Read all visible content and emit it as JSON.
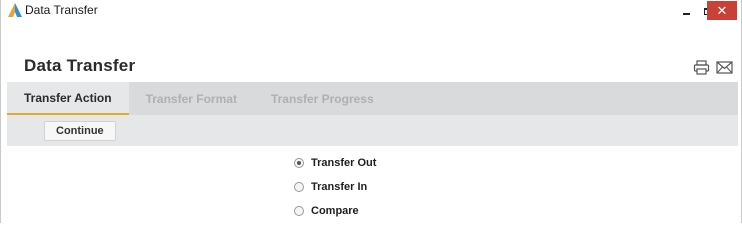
{
  "window": {
    "title": "Data Transfer",
    "icon": "app-logo-icon",
    "controls": {
      "minimize": "minimize-icon",
      "maximize": "maximize-icon",
      "close_label": "✕"
    }
  },
  "page": {
    "title": "Data Transfer",
    "icons": [
      "print-icon",
      "email-icon"
    ]
  },
  "tabs": [
    {
      "label": "Transfer Action",
      "active": true
    },
    {
      "label": "Transfer Format",
      "active": false
    },
    {
      "label": "Transfer Progress",
      "active": false
    }
  ],
  "actions": {
    "continue_label": "Continue"
  },
  "options": [
    {
      "label": "Transfer Out",
      "checked": true
    },
    {
      "label": "Transfer In",
      "checked": false
    },
    {
      "label": "Compare",
      "checked": false
    }
  ],
  "colors": {
    "tab_active_underline": "#e0ac2c",
    "close_button": "#c94036",
    "tabbar_bg": "#d9dadb"
  }
}
